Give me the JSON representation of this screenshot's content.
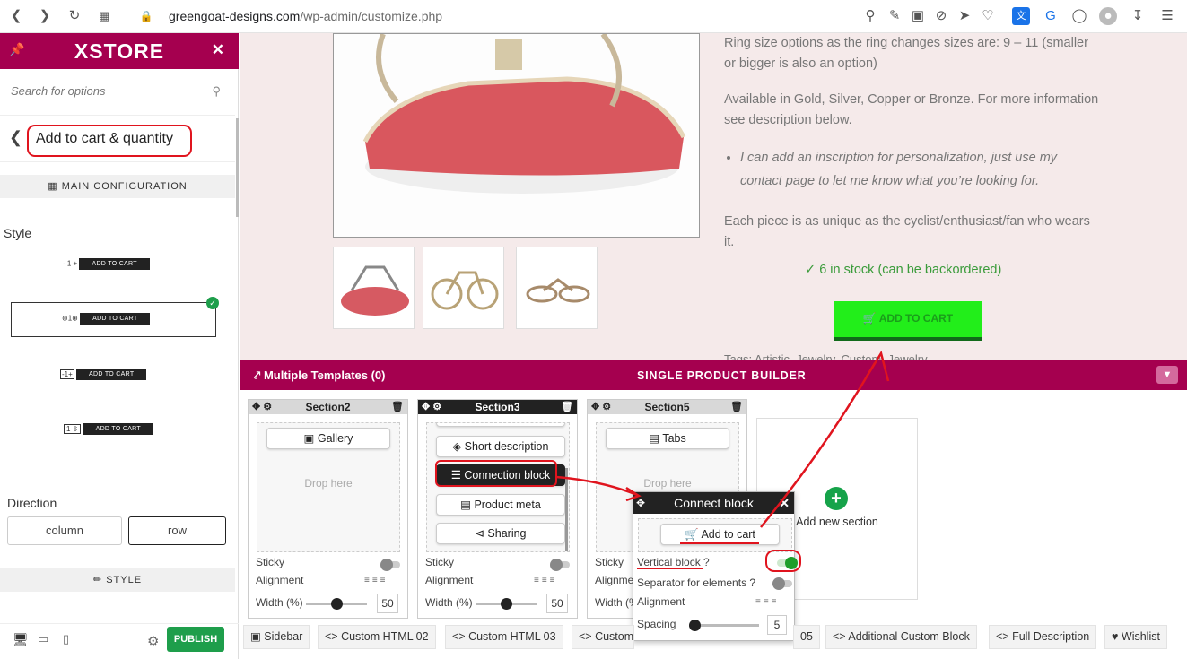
{
  "browser": {
    "url_host": "greengoat-designs.com",
    "url_path": "/wp-admin/customize.php"
  },
  "sidebar": {
    "logo": "XSTORE",
    "search_placeholder": "Search for options",
    "back_title": "Add to cart & quantity",
    "main_config": "MAIN CONFIGURATION",
    "style_label": "Style",
    "style_options": [
      {
        "qty": "- 1 +",
        "button": "ADD TO CART"
      },
      {
        "qty": "⊖1⊕",
        "button": "ADD TO CART",
        "selected": true
      },
      {
        "qty": "-1+",
        "button": "ADD TO CART"
      },
      {
        "qty": "1 ⇳",
        "button": "ADD TO CART"
      }
    ],
    "direction_label": "Direction",
    "direction_options": [
      "column",
      "row"
    ],
    "direction_selected": "row",
    "style_section": "STYLE",
    "publish": "PUBLISH"
  },
  "product": {
    "desc1": "Ring size options as the ring changes sizes are: 9 – 11 (smaller or bigger is also an option)",
    "desc2": "Available in Gold, Silver, Copper or Bronze. For more information see description below.",
    "bullet": "I can add an inscription for personalization, just use my contact page to let me know what you’re looking for.",
    "desc3": "Each piece is as unique as the cyclist/enthusiast/fan who wears it.",
    "stock": "6 in stock (can be backordered)",
    "add_to_cart": "ADD TO CART",
    "tags": "Tags: Artistic, Jewelry, Custom, Jewelry"
  },
  "builder": {
    "templates_label": "Multiple Templates (0)",
    "title": "SINGLE PRODUCT BUILDER",
    "sections": [
      {
        "name": "Section2",
        "blocks": [
          "Gallery"
        ],
        "drop": "Drop here",
        "sticky": "Sticky",
        "alignment": "Alignment",
        "width_label": "Width (%)",
        "width": 50
      },
      {
        "name": "Section3",
        "blocks": [
          "Short description",
          "Connection block",
          "Product meta",
          "Sharing"
        ],
        "sticky": "Sticky",
        "alignment": "Alignment",
        "width_label": "Width (%)",
        "width": 50
      },
      {
        "name": "Section5",
        "blocks": [
          "Tabs"
        ],
        "drop": "Drop here",
        "sticky": "Sticky",
        "alignment": "Alignme",
        "width_label": "Width (%"
      }
    ],
    "add_new_section": "Add new section"
  },
  "popup": {
    "title": "Connect block",
    "block": "Add to cart",
    "vertical": "Vertical block ?",
    "vertical_on": true,
    "separator": "Separator for elements ?",
    "separator_on": false,
    "alignment": "Alignment",
    "spacing_label": "Spacing",
    "spacing": 5
  },
  "tabs": [
    "Sidebar",
    "Custom HTML 02",
    "Custom HTML 03",
    "Custom",
    "05",
    "Additional Custom Block",
    "Full Description",
    "Wishlist"
  ]
}
